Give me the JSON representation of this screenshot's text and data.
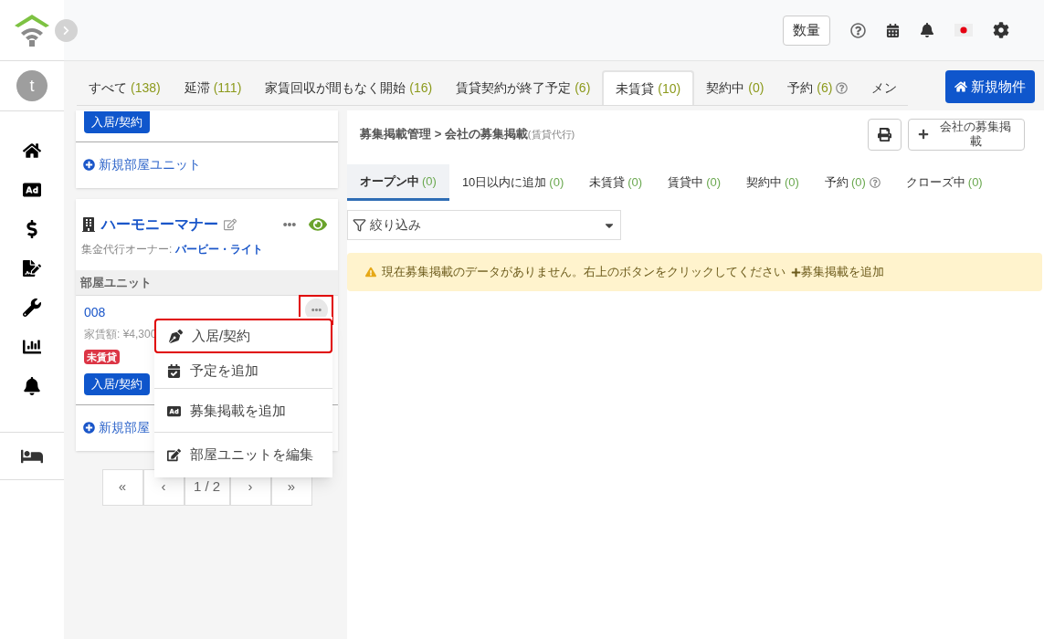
{
  "sidebar": {
    "avatar": "t"
  },
  "header": {
    "quantity_button": "数量"
  },
  "tabs": [
    {
      "label": "すべて",
      "count": "(138)",
      "help": false,
      "selected": false
    },
    {
      "label": "延滞",
      "count": "(111)",
      "help": false,
      "selected": false
    },
    {
      "label": "家賃回収が間もなく開始",
      "count": "(16)",
      "help": false,
      "selected": false
    },
    {
      "label": "賃貸契約が終了予定",
      "count": "(6)",
      "help": false,
      "selected": false
    },
    {
      "label": "未賃貸",
      "count": "(10)",
      "help": false,
      "selected": true
    },
    {
      "label": "契約中",
      "count": "(0)",
      "help": false,
      "selected": false
    },
    {
      "label": "予約",
      "count": "(6)",
      "help": true,
      "selected": false
    },
    {
      "label": "メン",
      "help": false,
      "selected": false
    }
  ],
  "new_property_button": "新規物件",
  "top_card": {
    "contract_button": "入居/契約",
    "add_unit_link": "新規部屋ユニット"
  },
  "property": {
    "name": "ハーモニーマナー",
    "owner_label": "集金代行オーナー:",
    "owner": "バービー・ライト",
    "visible": true,
    "units_header": "部屋ユニット",
    "units": [
      {
        "number": "008",
        "rent": "家賃額: ¥4,300",
        "status": "未賃貸",
        "color": "#dc3545",
        "contract_button": "入居/契約",
        "menu_highlighted": true
      }
    ],
    "add_unit_link": "新規部屋"
  },
  "pagination": [
    "«",
    "‹",
    "1 / 2",
    "›",
    "»"
  ],
  "menu": [
    {
      "kind": "contract",
      "label": "入居/契約",
      "separated": false,
      "highlighted": true
    },
    {
      "kind": "schedule",
      "label": "予定を追加",
      "separated": false,
      "highlighted": false
    },
    {
      "kind": "ad",
      "label": "募集掲載を追加",
      "separated": true,
      "highlighted": false
    },
    {
      "kind": "edit",
      "label": "部屋ユニットを編集",
      "separated": true,
      "highlighted": false
    }
  ],
  "panel": {
    "breadcrumb": [
      "募集掲載管理",
      ">",
      "会社の募集掲載"
    ],
    "breadcrumb_note": "(賃貸代行)",
    "add_button": "会社の募集掲載",
    "tabs": [
      {
        "label": "オープン中",
        "count": "(0)",
        "help": false,
        "selected": true
      },
      {
        "label": "10日以内に追加",
        "count": "(0)",
        "help": false,
        "selected": false
      },
      {
        "label": "未賃貸",
        "count": "(0)",
        "help": false,
        "selected": false
      },
      {
        "label": "賃貸中",
        "count": "(0)",
        "help": false,
        "selected": false
      },
      {
        "label": "契約中",
        "count": "(0)",
        "help": false,
        "selected": false
      },
      {
        "label": "予約",
        "count": "(0)",
        "help": true,
        "selected": false
      },
      {
        "label": "クローズ中",
        "count": "(0)",
        "help": false,
        "selected": false
      }
    ],
    "filter": {
      "placeholder": "絞り込み"
    },
    "alert": "現在募集掲載のデータがありません。右上のボタンをクリックしてください",
    "alert_link": "募集掲載を追加"
  }
}
